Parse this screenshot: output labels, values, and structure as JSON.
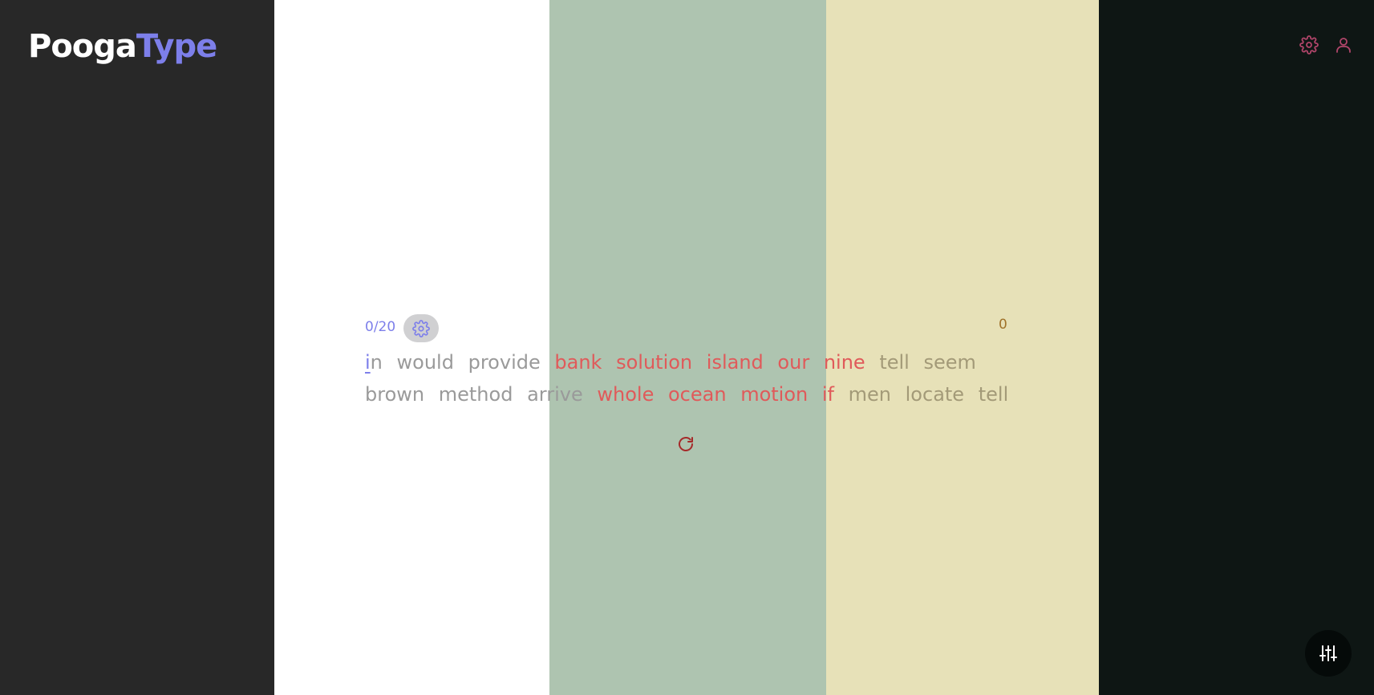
{
  "brand": {
    "part1": "Pooga",
    "part2": "Type"
  },
  "header": {
    "settings_icon": "gear-icon",
    "profile_icon": "user-icon"
  },
  "test": {
    "progress": "0/20",
    "wpm": "0",
    "first_word_cursor_letter": "i",
    "first_word_rest": "n",
    "line1": [
      "would",
      "provide",
      "bank",
      "solution",
      "island",
      "our",
      "nine",
      "tell",
      "seem"
    ],
    "line2": [
      "brown",
      "method",
      "arrive",
      "whole",
      "ocean",
      "motion",
      "if",
      "men",
      "locate",
      "tell"
    ],
    "restart_icon": "restart-icon",
    "quick_settings_icon": "sliders-icon"
  },
  "colors": {
    "band_dark": "#282828",
    "band_white": "#ffffff",
    "band_sage": "#aec4b0",
    "band_cream": "#e7e1b8",
    "band_black": "#0e1614",
    "accent": "#7d7fea",
    "error": "#e05a5a"
  }
}
